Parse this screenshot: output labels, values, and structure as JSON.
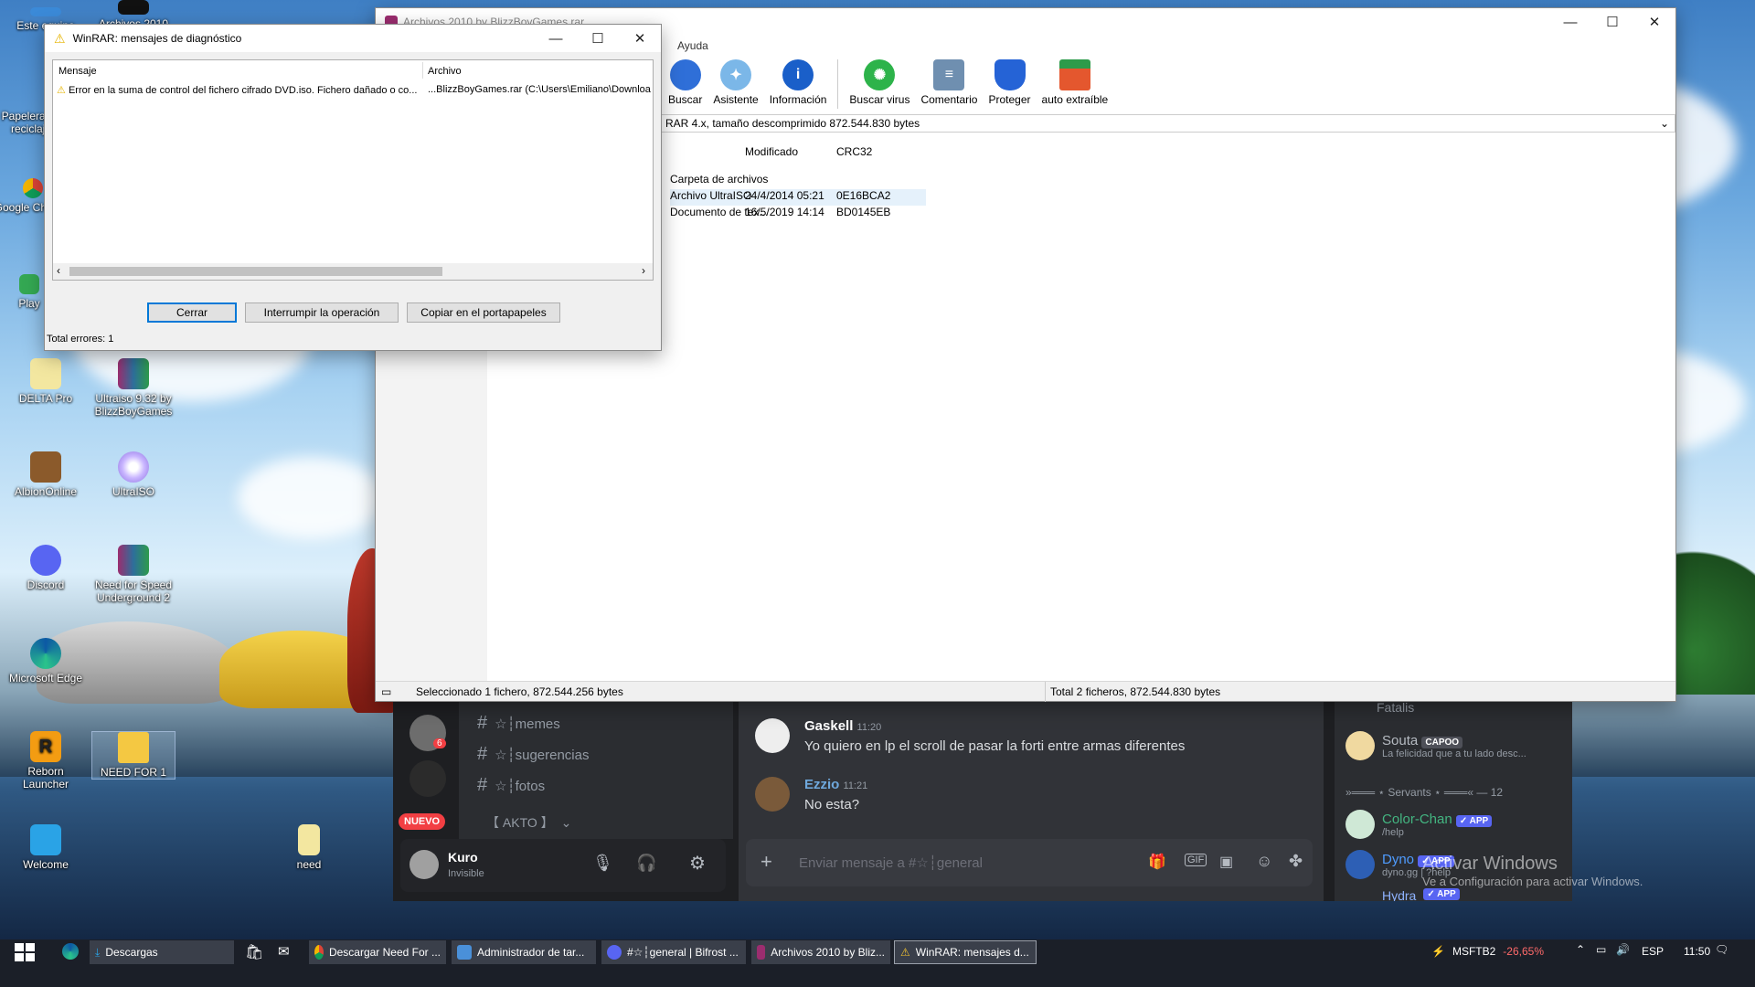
{
  "desktop": {
    "icons": [
      {
        "label": "Este equipo"
      },
      {
        "label": "Archivos 2010"
      },
      {
        "label": "Papelera de reciclaje"
      },
      {
        "label": "Google Chrome"
      },
      {
        "label": "Play"
      },
      {
        "label": "DELTA Pro"
      },
      {
        "label": "Ultraiso 9.32 by BlizzBoyGames"
      },
      {
        "label": "AlbionOnline"
      },
      {
        "label": "UltraISO"
      },
      {
        "label": "Discord"
      },
      {
        "label": "Need for Speed Underground 2"
      },
      {
        "label": "Microsoft Edge"
      },
      {
        "label": "Reborn Launcher"
      },
      {
        "label": "NEED FOR 1"
      },
      {
        "label": "Welcome"
      },
      {
        "label": "need"
      }
    ]
  },
  "winrar": {
    "title": "Archivos 2010 by BlizzBoyGames.rar",
    "menu_help": "Ayuda",
    "toolbar": [
      {
        "label": "Buscar",
        "color": "#2f6fd8"
      },
      {
        "label": "Asistente",
        "color": "#7bb7e8"
      },
      {
        "label": "Información",
        "color": "#1a5fc9"
      },
      {
        "label": "Buscar virus",
        "color": "#2db34a"
      },
      {
        "label": "Comentario",
        "color": "#6f8fb0"
      },
      {
        "label": "Proteger",
        "color": "#2563d6"
      },
      {
        "label": "auto extraíble",
        "color": "#e4572e"
      }
    ],
    "path_info": "RAR 4.x, tamaño descomprimido 872.544.830 bytes",
    "columns": {
      "modified": "Modificado",
      "crc": "CRC32"
    },
    "rows": [
      {
        "name": "Carpeta de archivos",
        "modified": "",
        "crc": ""
      },
      {
        "name": "Archivo UltraISO",
        "modified": "24/4/2014 05:21",
        "crc": "0E16BCA2"
      },
      {
        "name": "Documento de tex...",
        "modified": "16/5/2019 14:14",
        "crc": "BD0145EB"
      }
    ],
    "status_left": "Seleccionado 1 fichero, 872.544.256 bytes",
    "status_right": "Total 2 ficheros, 872.544.830 bytes"
  },
  "diag": {
    "title": "WinRAR: mensajes de diagnóstico",
    "col_message": "Mensaje",
    "col_file": "Archivo",
    "row_message": "Error en la suma de control del fichero cifrado DVD.iso. Fichero dañado o co...",
    "row_file": "...BlizzBoyGames.rar (C:\\Users\\Emiliano\\Downloads\\",
    "btn_close": "Cerrar",
    "btn_interrupt": "Interrumpir la operación",
    "btn_copy": "Copiar en el portapapeles",
    "total": "Total errores: 1"
  },
  "discord": {
    "channels": [
      {
        "name": "☆┆memes"
      },
      {
        "name": "☆┆sugerencias"
      },
      {
        "name": "☆┆fotos"
      }
    ],
    "category": "【 AKTO 】",
    "server_badge_count": "6",
    "new_badge": "NUEVO",
    "user": {
      "name": "Kuro",
      "status": "Invisible"
    },
    "messages": [
      {
        "author": "Gaskell",
        "time": "11:20",
        "text": "Yo quiero en lp el scroll de pasar la forti entre armas diferentes",
        "color": "#ffffff"
      },
      {
        "author": "Ezzio",
        "time": "11:21",
        "text": "No esta?",
        "color": "#6fa8dc"
      }
    ],
    "input_placeholder": "Enviar mensaje a #☆┆general",
    "members": {
      "top_name": "Fatalis",
      "souta": {
        "name": "Souta",
        "tag": "CAPOO",
        "status": "La felicidad que a tu lado desc..."
      },
      "section": "»═══ ⋆ Servants ⋆ ═══« — 12",
      "bots": [
        {
          "name": "Color-Chan",
          "tag": "✓ APP",
          "sub": "/help",
          "color": "#43b581"
        },
        {
          "name": "Dyno",
          "tag": "✓ APP",
          "sub": "dyno.gg | ?help",
          "color": "#4f9cff"
        },
        {
          "name": "Hydra",
          "tag": "✓ APP",
          "sub": "",
          "color": "#8fb3ff"
        }
      ]
    },
    "watermark": {
      "title": "Activar Windows",
      "sub": "Ve a Configuración para activar Windows."
    }
  },
  "taskbar": {
    "items": [
      {
        "label": "Descargas",
        "color": "#2aa3e6"
      },
      {
        "label": "Descargar Need For ...",
        "color": "#e74c3c"
      },
      {
        "label": "Administrador de tar...",
        "color": "#4a90d9"
      },
      {
        "label": "#☆┆general | Bifrost ...",
        "color": "#5865f2"
      },
      {
        "label": "Archivos 2010 by Bliz...",
        "color": "#9b2d6f"
      },
      {
        "label": "WinRAR: mensajes d...",
        "color": "#f2c230"
      }
    ],
    "stock": {
      "name": "MSFTB2",
      "change": "-26,65%"
    },
    "lang": "ESP",
    "time": "11:50"
  }
}
